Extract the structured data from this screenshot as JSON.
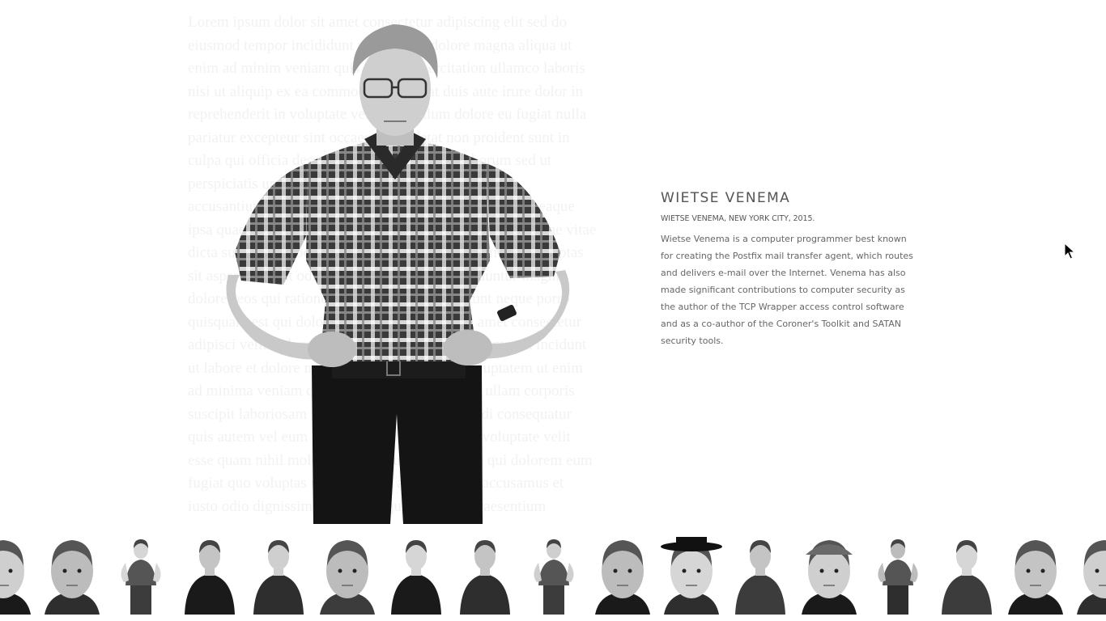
{
  "person": {
    "name": "WIETSE VENEMA",
    "caption": "WIETSE VENEMA, NEW YORK CITY, 2015.",
    "bio": "Wietse Venema is a computer programmer best known for creating the Postfix mail transfer agent, which routes and delivers e-mail over the Internet. Venema has also made significant contributions to computer security as the author of the TCP Wrapper access control software and as a co-author of the Coroner's Toolkit and SATAN security tools."
  },
  "portrait": {
    "icon": "portrait-photo",
    "style": "black-and-white"
  },
  "colors": {
    "background": "#ffffff",
    "heading": "#555555",
    "body_text": "#666666",
    "ghost_text": "#f2f2f2"
  },
  "thumbnail_strip": {
    "count": 17,
    "items": [
      {
        "id": "thumb-1",
        "kind": "face"
      },
      {
        "id": "thumb-2",
        "kind": "face"
      },
      {
        "id": "thumb-3",
        "kind": "full-body"
      },
      {
        "id": "thumb-4",
        "kind": "half-body"
      },
      {
        "id": "thumb-5",
        "kind": "half-body"
      },
      {
        "id": "thumb-6",
        "kind": "face"
      },
      {
        "id": "thumb-7",
        "kind": "half-body"
      },
      {
        "id": "thumb-8",
        "kind": "half-body"
      },
      {
        "id": "thumb-9",
        "kind": "full-body"
      },
      {
        "id": "thumb-10",
        "kind": "face"
      },
      {
        "id": "thumb-11",
        "kind": "hat-face"
      },
      {
        "id": "thumb-12",
        "kind": "half-body"
      },
      {
        "id": "thumb-13",
        "kind": "cap-face"
      },
      {
        "id": "thumb-14",
        "kind": "full-body"
      },
      {
        "id": "thumb-15",
        "kind": "half-body"
      },
      {
        "id": "thumb-16",
        "kind": "face"
      },
      {
        "id": "thumb-17",
        "kind": "face"
      }
    ]
  }
}
